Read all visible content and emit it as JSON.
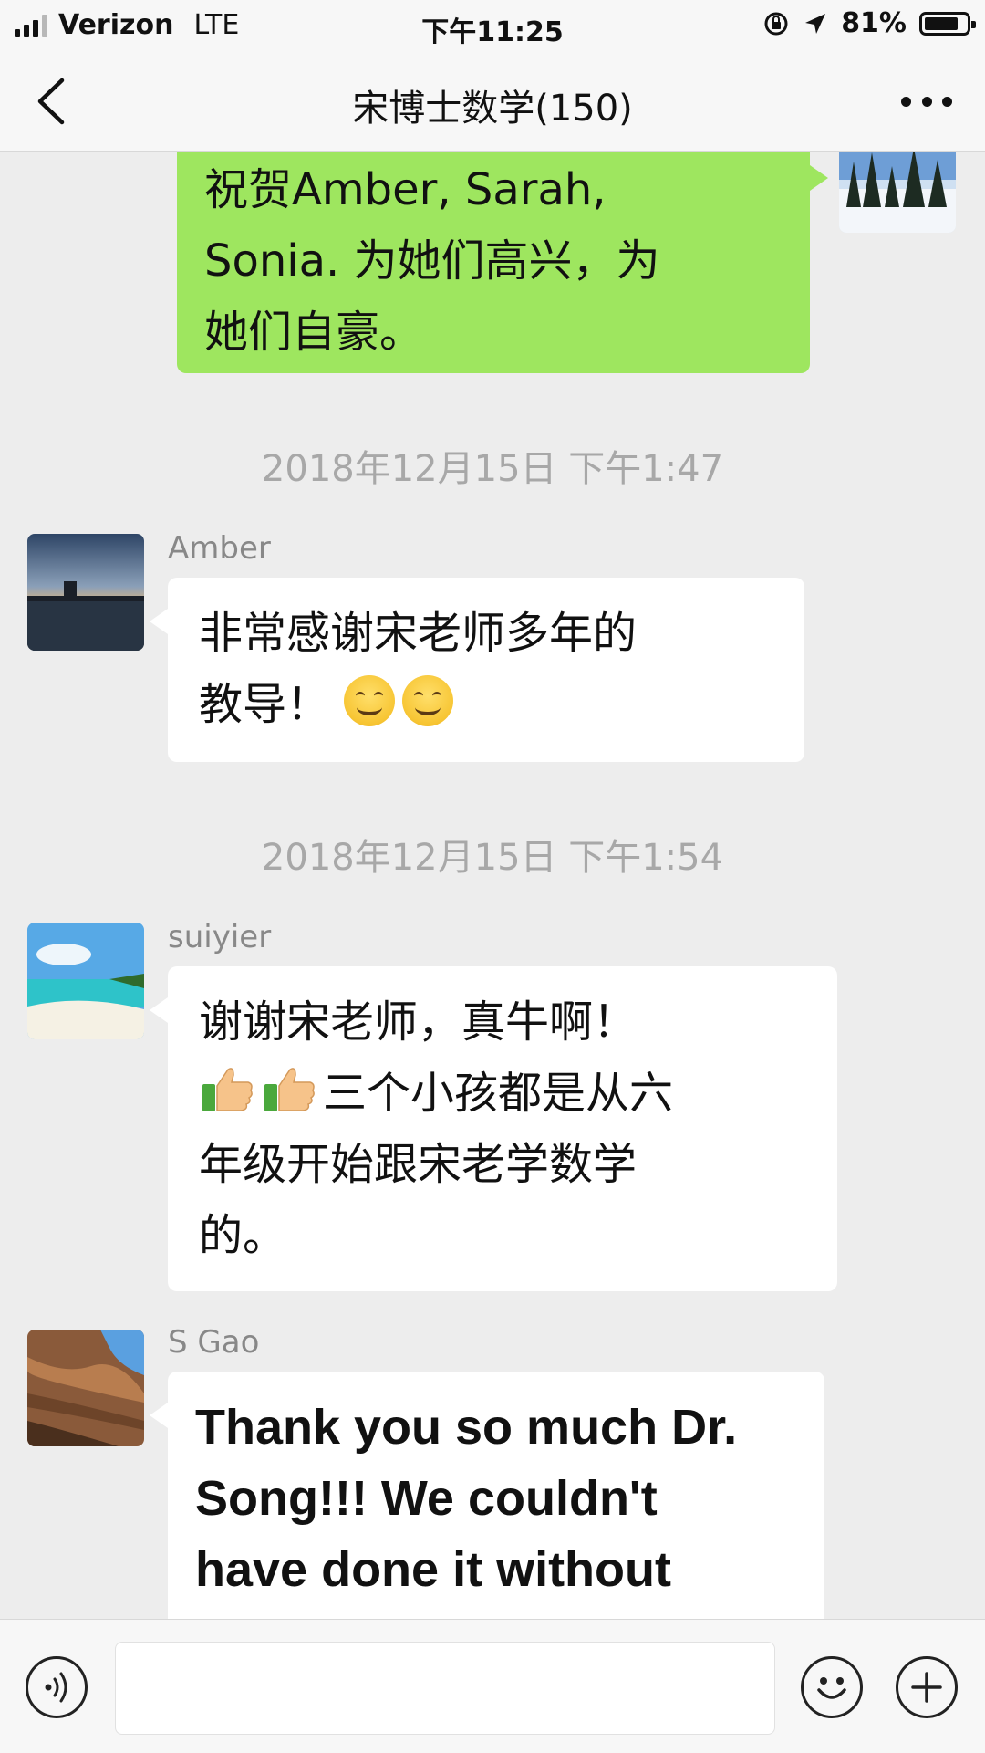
{
  "status_bar": {
    "carrier": "Verizon",
    "network": "LTE",
    "time": "下午11:25",
    "battery_text": "81%",
    "battery_level": 0.81
  },
  "nav": {
    "title": "宋博士数学(150)",
    "back_icon": "chevron-left-icon",
    "more_icon": "more-dots-icon"
  },
  "messages": [
    {
      "side": "right",
      "lines": [
        "祝贺Amber, Sarah,",
        "Sonia. 为她们高兴，为",
        "她们自豪。"
      ]
    },
    {
      "timestamp": "2018年12月15日 下午1:47"
    },
    {
      "side": "left",
      "sender": "Amber",
      "lines": [
        "非常感谢宋老师多年的",
        "教导！"
      ]
    },
    {
      "timestamp": "2018年12月15日 下午1:54"
    },
    {
      "side": "left",
      "sender": "suiyier",
      "lines": [
        "谢谢宋老师，真牛啊！",
        "三个小孩都是从六",
        "年级开始跟宋老学数学",
        "的。"
      ]
    },
    {
      "side": "left",
      "sender": "S Gao",
      "lines": [
        "Thank you so much Dr.",
        "Song!!! We couldn't",
        "have done it without"
      ]
    }
  ],
  "input_bar": {
    "voice_icon": "voice-icon",
    "emoji_icon": "emoji-icon",
    "plus_icon": "plus-icon"
  },
  "colors": {
    "sent_bubble": "#9ee65f",
    "received_bubble": "#ffffff",
    "background": "#ededed"
  }
}
